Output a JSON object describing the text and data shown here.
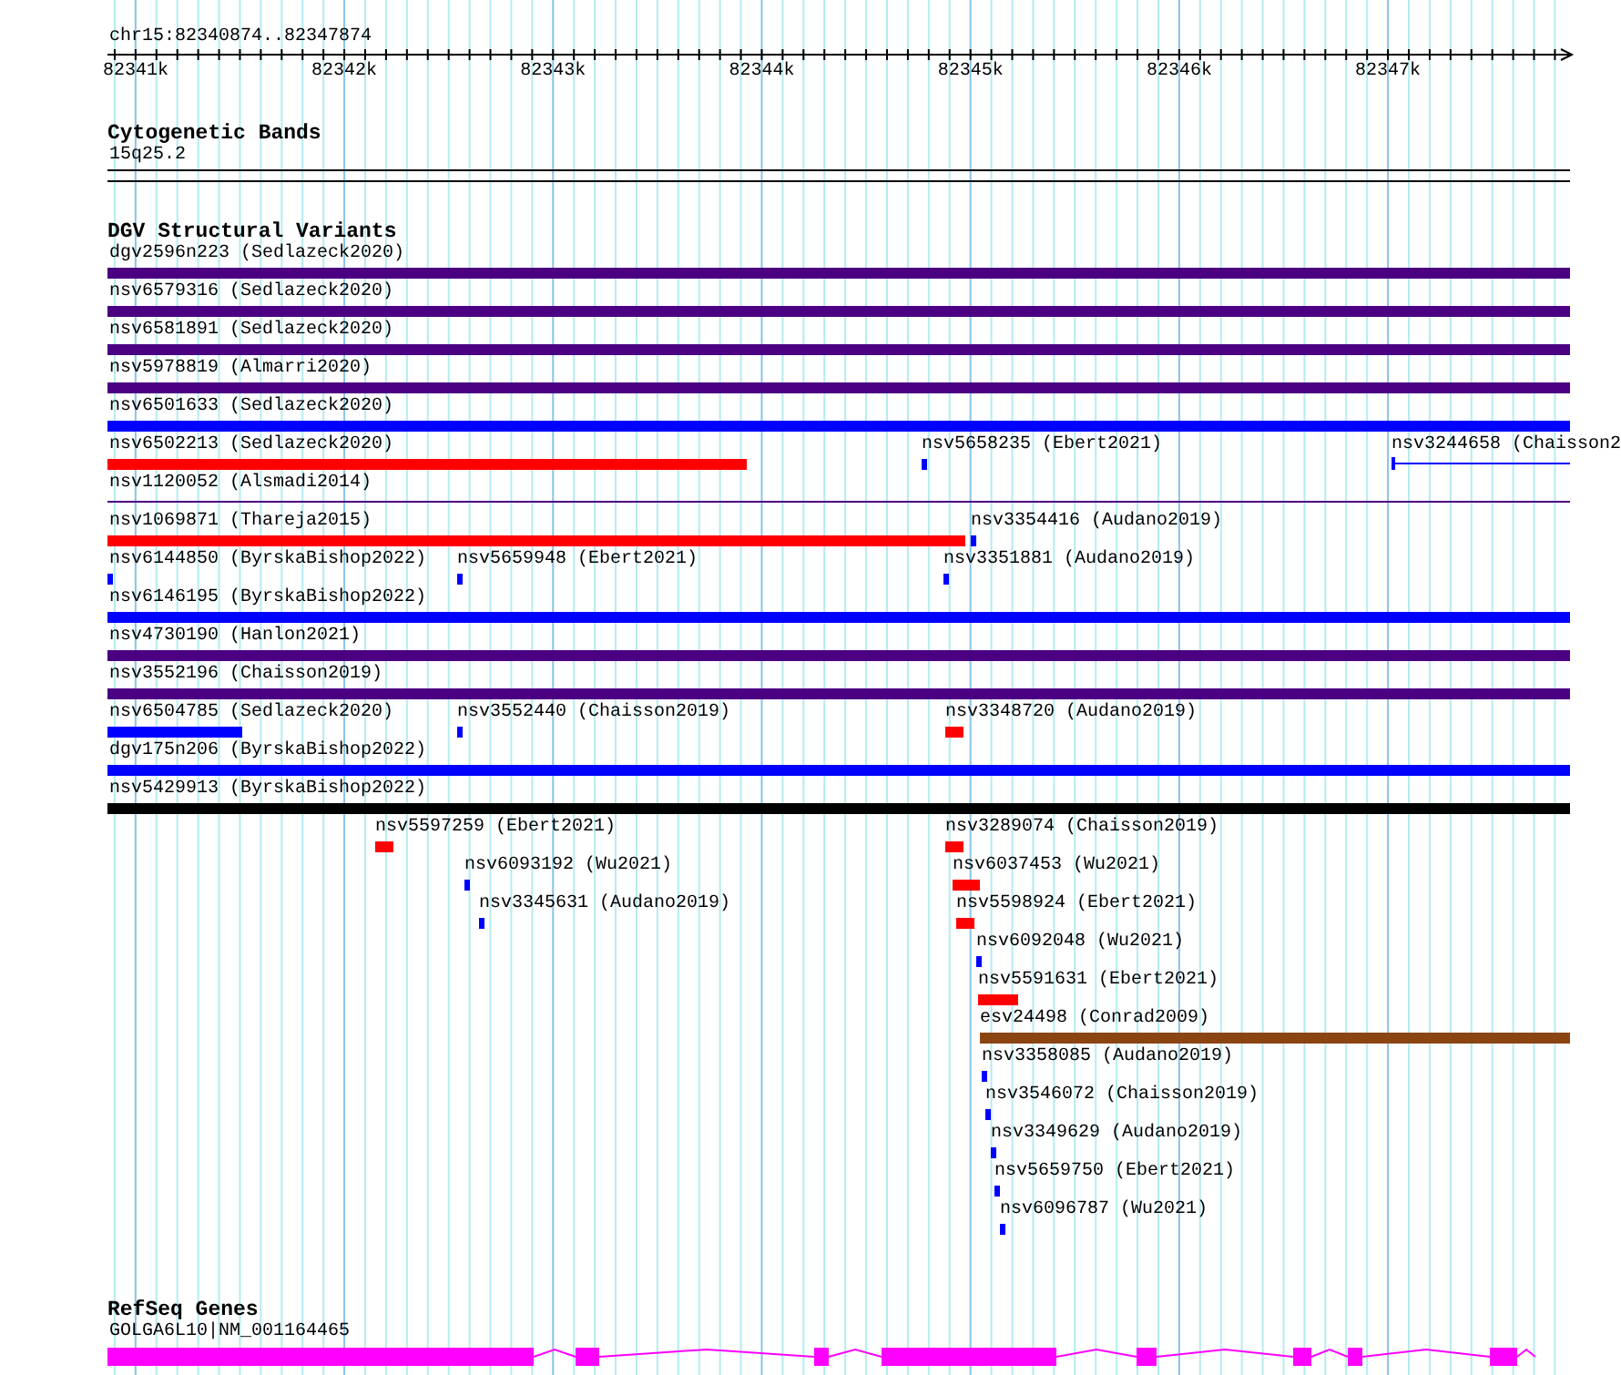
{
  "ruler": {
    "locus": "chr15:82340874..82347874",
    "ticks": [
      "82341k",
      "82342k",
      "82343k",
      "82344k",
      "82345k",
      "82346k",
      "82347k"
    ]
  },
  "cytogenetic_bands": {
    "title": "Cytogenetic Bands",
    "band": "15q25.2"
  },
  "dgv_structural_variants": {
    "title": "DGV Structural Variants",
    "rows": [
      {
        "features": [
          {
            "label": "dgv2596n223 (Sedlazeck2020)",
            "kind": "bar",
            "color": "#4b0082"
          }
        ]
      },
      {
        "features": [
          {
            "label": "nsv6579316 (Sedlazeck2020)",
            "kind": "bar",
            "color": "#4b0082"
          }
        ]
      },
      {
        "features": [
          {
            "label": "nsv6581891 (Sedlazeck2020)",
            "kind": "bar",
            "color": "#4b0082"
          }
        ]
      },
      {
        "features": [
          {
            "label": "nsv5978819 (Almarri2020)",
            "kind": "bar",
            "color": "#4b0082"
          }
        ]
      },
      {
        "features": [
          {
            "label": "nsv6501633 (Sedlazeck2020)",
            "kind": "bar",
            "color": "#0000ff"
          }
        ]
      },
      {
        "features": [
          {
            "label": "nsv6502213 (Sedlazeck2020)",
            "kind": "bar",
            "color": "#ff0000"
          },
          {
            "label": "nsv5658235 (Ebert2021)",
            "kind": "bar",
            "color": "#0000ff"
          },
          {
            "label": "nsv3244658 (Chaisson2",
            "kind": "range",
            "color": "#0000ff"
          }
        ]
      },
      {
        "features": [
          {
            "label": "nsv1120052 (Alsmadi2014)",
            "kind": "line",
            "color": "#4b0082"
          }
        ]
      },
      {
        "features": [
          {
            "label": "nsv1069871 (Thareja2015)",
            "kind": "bar",
            "color": "#ff0000"
          },
          {
            "label": "nsv3354416 (Audano2019)",
            "kind": "bar",
            "color": "#0000ff"
          }
        ]
      },
      {
        "features": [
          {
            "label": "nsv6144850 (ByrskaBishop2022)",
            "kind": "bar",
            "color": "#0000ff"
          },
          {
            "label": "nsv5659948 (Ebert2021)",
            "kind": "bar",
            "color": "#0000ff"
          },
          {
            "label": "nsv3351881 (Audano2019)",
            "kind": "bar",
            "color": "#0000ff"
          }
        ]
      },
      {
        "features": [
          {
            "label": "nsv6146195 (ByrskaBishop2022)",
            "kind": "bar",
            "color": "#0000ff"
          }
        ]
      },
      {
        "features": [
          {
            "label": "nsv4730190 (Hanlon2021)",
            "kind": "bar",
            "color": "#4b0082"
          }
        ]
      },
      {
        "features": [
          {
            "label": "nsv3552196 (Chaisson2019)",
            "kind": "bar",
            "color": "#4b0082"
          }
        ]
      },
      {
        "features": [
          {
            "label": "nsv6504785 (Sedlazeck2020)",
            "kind": "bar",
            "color": "#0000ff"
          },
          {
            "label": "nsv3552440 (Chaisson2019)",
            "kind": "bar",
            "color": "#0000ff"
          },
          {
            "label": "nsv3348720 (Audano2019)",
            "kind": "bar",
            "color": "#ff0000"
          }
        ]
      },
      {
        "features": [
          {
            "label": "dgv175n206 (ByrskaBishop2022)",
            "kind": "bar",
            "color": "#0000ff"
          }
        ]
      },
      {
        "features": [
          {
            "label": "nsv5429913 (ByrskaBishop2022)",
            "kind": "bar",
            "color": "#000000"
          }
        ]
      },
      {
        "features": [
          {
            "label": "nsv5597259 (Ebert2021)",
            "kind": "bar",
            "color": "#ff0000"
          },
          {
            "label": "nsv3289074 (Chaisson2019)",
            "kind": "bar",
            "color": "#ff0000"
          }
        ]
      },
      {
        "features": [
          {
            "label": "nsv6093192 (Wu2021)",
            "kind": "bar",
            "color": "#0000ff"
          },
          {
            "label": "nsv6037453 (Wu2021)",
            "kind": "bar",
            "color": "#ff0000"
          }
        ]
      },
      {
        "features": [
          {
            "label": "nsv3345631 (Audano2019)",
            "kind": "bar",
            "color": "#0000ff"
          },
          {
            "label": "nsv5598924 (Ebert2021)",
            "kind": "bar",
            "color": "#ff0000"
          }
        ]
      },
      {
        "features": [
          {
            "label": "nsv6092048 (Wu2021)",
            "kind": "bar",
            "color": "#0000ff"
          }
        ]
      },
      {
        "features": [
          {
            "label": "nsv5591631 (Ebert2021)",
            "kind": "bar",
            "color": "#ff0000"
          }
        ]
      },
      {
        "features": [
          {
            "label": "esv24498 (Conrad2009)",
            "kind": "bar",
            "color": "#8b4513"
          }
        ]
      },
      {
        "features": [
          {
            "label": "nsv3358085 (Audano2019)",
            "kind": "bar",
            "color": "#0000ff"
          }
        ]
      },
      {
        "features": [
          {
            "label": "nsv3546072 (Chaisson2019)",
            "kind": "bar",
            "color": "#0000ff"
          }
        ]
      },
      {
        "features": [
          {
            "label": "nsv3349629 (Audano2019)",
            "kind": "bar",
            "color": "#0000ff"
          }
        ]
      },
      {
        "features": [
          {
            "label": "nsv5659750 (Ebert2021)",
            "kind": "bar",
            "color": "#0000ff"
          }
        ]
      },
      {
        "features": [
          {
            "label": "nsv6096787 (Wu2021)",
            "kind": "bar",
            "color": "#0000ff"
          }
        ]
      }
    ]
  },
  "refseq_genes": {
    "title": "RefSeq Genes",
    "gene": "GOLGA6L10|NM_001164465"
  }
}
